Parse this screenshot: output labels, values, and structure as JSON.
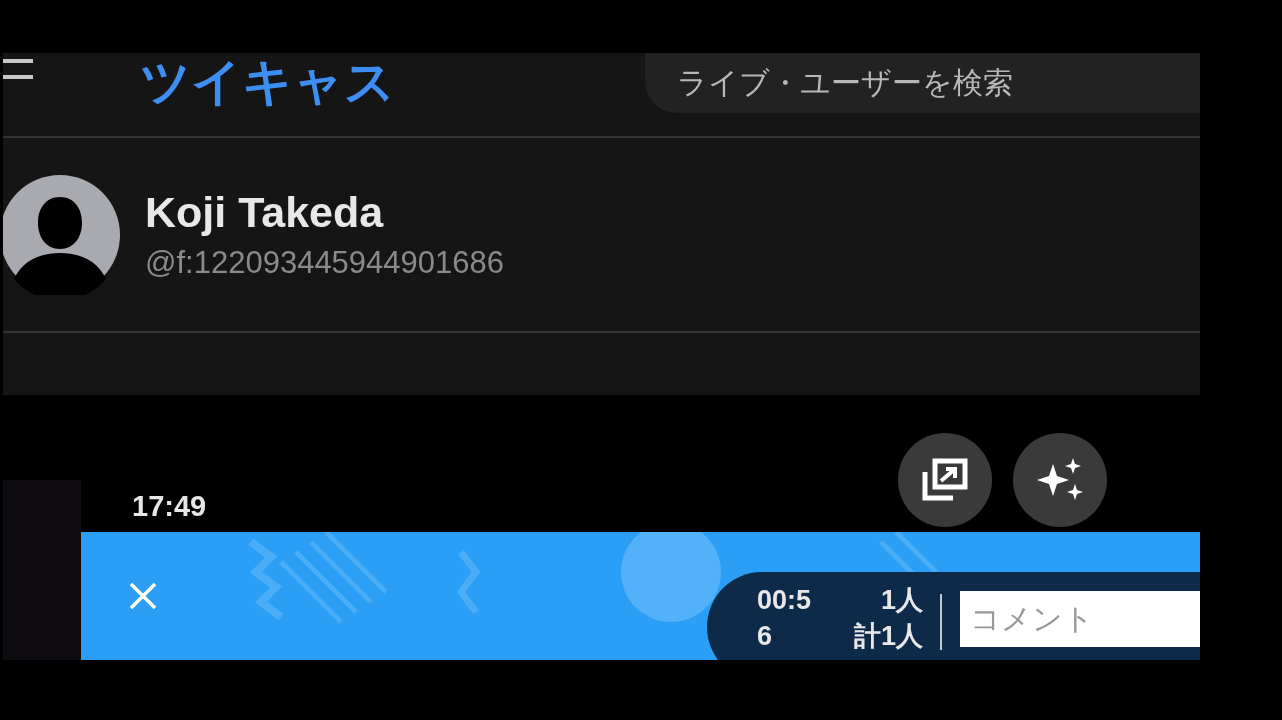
{
  "header": {
    "logo": "ツイキャス",
    "search": {
      "placeholder": "ライブ・ユーザーを検索"
    }
  },
  "profile": {
    "name": "Koji Takeda",
    "handle": "@f:122093445944901686"
  },
  "player": {
    "time": "17:49",
    "timer": "00:56",
    "viewers": "1人",
    "total_viewers": "計1人",
    "comment": {
      "placeholder": "コメント"
    }
  }
}
